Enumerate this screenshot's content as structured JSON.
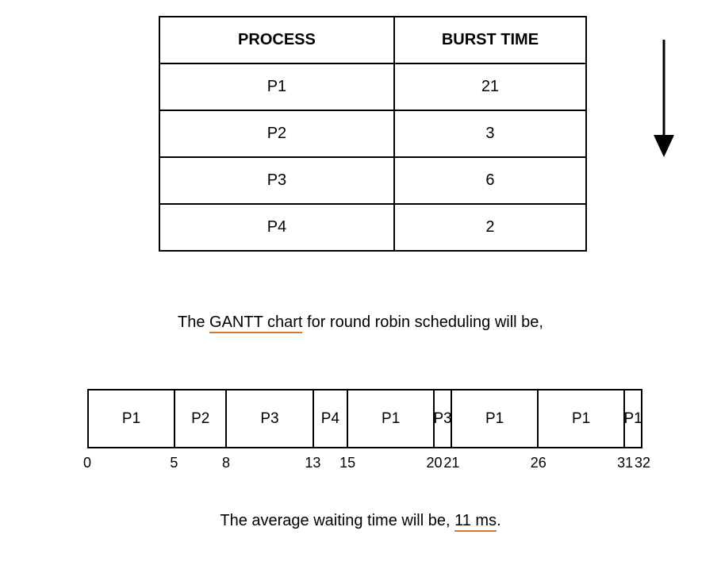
{
  "table": {
    "headers": {
      "process": "PROCESS",
      "burst": "BURST TIME"
    },
    "rows": [
      {
        "process": "P1",
        "burst": "21"
      },
      {
        "process": "P2",
        "burst": "3"
      },
      {
        "process": "P3",
        "burst": "6"
      },
      {
        "process": "P4",
        "burst": "2"
      }
    ]
  },
  "caption1": {
    "pre": "The ",
    "underlined": "GANTT chart",
    "post": " for round robin scheduling will be,"
  },
  "gantt": {
    "total": 32,
    "segments": [
      {
        "label": "P1",
        "start": 0,
        "end": 5
      },
      {
        "label": "P2",
        "start": 5,
        "end": 8
      },
      {
        "label": "P3",
        "start": 8,
        "end": 13
      },
      {
        "label": "P4",
        "start": 13,
        "end": 15
      },
      {
        "label": "P1",
        "start": 15,
        "end": 20
      },
      {
        "label": "P3",
        "start": 20,
        "end": 21
      },
      {
        "label": "P1",
        "start": 21,
        "end": 26
      },
      {
        "label": "P1",
        "start": 26,
        "end": 31
      },
      {
        "label": "P1",
        "start": 31,
        "end": 32
      }
    ],
    "ticks": [
      "0",
      "5",
      "8",
      "13",
      "15",
      "20",
      "21",
      "26",
      "31",
      "32"
    ]
  },
  "caption2": {
    "pre": "The average waiting time will be, ",
    "underlined": "11 ms",
    "post": "."
  },
  "chart_data": {
    "type": "table",
    "title": "Round Robin scheduling (time quantum = 5)",
    "processes": [
      {
        "name": "P1",
        "burst_time": 21
      },
      {
        "name": "P2",
        "burst_time": 3
      },
      {
        "name": "P3",
        "burst_time": 6
      },
      {
        "name": "P4",
        "burst_time": 2
      }
    ],
    "gantt": [
      {
        "process": "P1",
        "from": 0,
        "to": 5
      },
      {
        "process": "P2",
        "from": 5,
        "to": 8
      },
      {
        "process": "P3",
        "from": 8,
        "to": 13
      },
      {
        "process": "P4",
        "from": 13,
        "to": 15
      },
      {
        "process": "P1",
        "from": 15,
        "to": 20
      },
      {
        "process": "P3",
        "from": 20,
        "to": 21
      },
      {
        "process": "P1",
        "from": 21,
        "to": 26
      },
      {
        "process": "P1",
        "from": 26,
        "to": 31
      },
      {
        "process": "P1",
        "from": 31,
        "to": 32
      }
    ],
    "average_waiting_time_ms": 11
  }
}
